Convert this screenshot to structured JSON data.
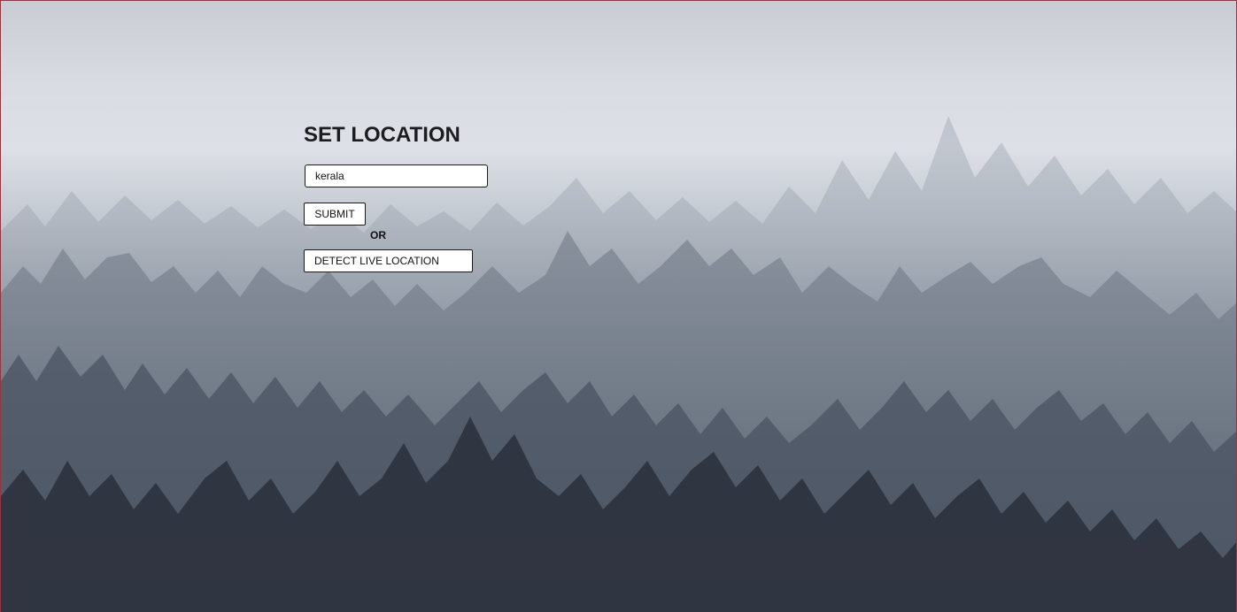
{
  "location_form": {
    "title": "SET LOCATION",
    "input_value": "kerala",
    "submit_label": "SUBMIT",
    "or_label": "OR",
    "detect_label": "DETECT LIVE LOCATION"
  },
  "colors": {
    "sky_top": "#c9ccd3",
    "fog": "#dde0e6",
    "forest_dark": "#262b35",
    "title_text": "#1b1d21",
    "control_bg": "#ffffff",
    "control_border": "#1a1a1a"
  }
}
